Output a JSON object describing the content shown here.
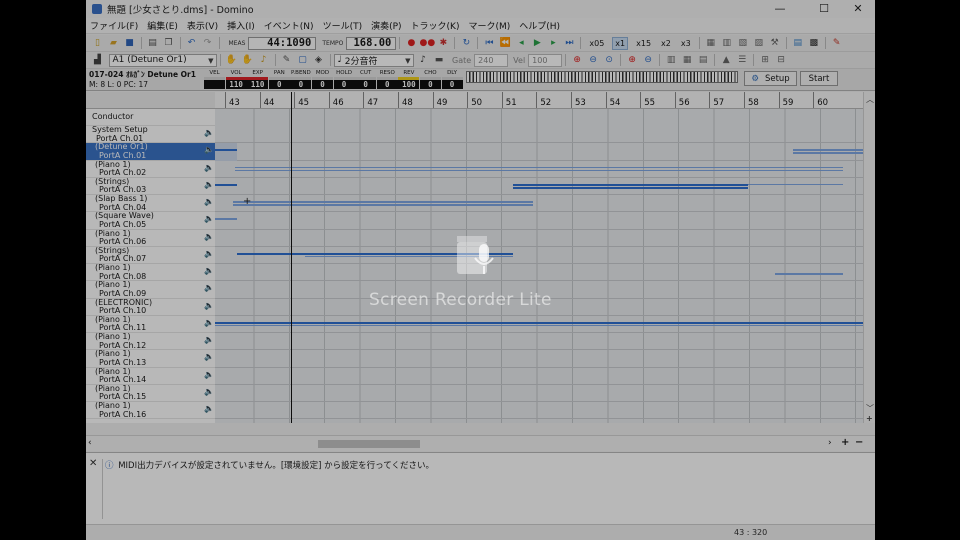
{
  "window": {
    "title": "無題 [少女さとり.dms] - Domino",
    "controls": [
      "—",
      "☐",
      "✕"
    ]
  },
  "menu": [
    "ファイル(F)",
    "編集(E)",
    "表示(V)",
    "挿入(I)",
    "イベント(N)",
    "ツール(T)",
    "演奏(P)",
    "トラック(K)",
    "マーク(M)",
    "ヘルプ(H)"
  ],
  "toolbar1": {
    "meas_label": "MEAS",
    "meas_value": "44:1090",
    "tempo_label": "TEMPO",
    "tempo_value": "168.00",
    "zoom": [
      "x05",
      "x1",
      "x15",
      "x2",
      "x3"
    ],
    "active_zoom": "x1"
  },
  "toolbar2": {
    "track_select": "A1  (Detune Or1)",
    "note_length": "2分音符",
    "gate_label": "Gate",
    "gate_value": "240",
    "vel_label": "Vel",
    "vel_value": "100"
  },
  "track_info": {
    "line1": "017-024 ｵﾙｶﾞﾝ Detune Or1",
    "line2": "M:    8   L:    0  PC:   17"
  },
  "params": [
    {
      "label": "VEL",
      "value": "",
      "color": "#d6d6d6"
    },
    {
      "label": "VOL",
      "value": "110",
      "color": "#e0242a"
    },
    {
      "label": "EXP",
      "value": "110",
      "color": "#e0242a"
    },
    {
      "label": "PAN",
      "value": "0",
      "color": "#d6d6d6"
    },
    {
      "label": "P.BEND",
      "value": "0",
      "color": "#d6d6d6"
    },
    {
      "label": "MOD",
      "value": "0",
      "color": "#d6d6d6"
    },
    {
      "label": "HOLD",
      "value": "0",
      "color": "#d6d6d6"
    },
    {
      "label": "CUT",
      "value": "0",
      "color": "#d6d6d6"
    },
    {
      "label": "RESO",
      "value": "0",
      "color": "#d6d6d6"
    },
    {
      "label": "REV",
      "value": "100",
      "color": "#f0d020"
    },
    {
      "label": "CHO",
      "value": "0",
      "color": "#d6d6d6"
    },
    {
      "label": "DLY",
      "value": "0",
      "color": "#d6d6d6"
    }
  ],
  "buttons": {
    "setup": "Setup",
    "start": "Start"
  },
  "ruler": [
    "43",
    "44",
    "45",
    "46",
    "47",
    "48",
    "49",
    "50",
    "51",
    "52",
    "53",
    "54",
    "55",
    "56",
    "57",
    "58",
    "59",
    "60"
  ],
  "conductor": "Conductor",
  "tracks": [
    {
      "name": "System Setup",
      "port": "PortA  Ch.01"
    },
    {
      "name": "(Detune Or1)",
      "port": "PortA  Ch.01"
    },
    {
      "name": "(Piano 1)",
      "port": "PortA  Ch.02"
    },
    {
      "name": "(Strings)",
      "port": "PortA  Ch.03"
    },
    {
      "name": "(Slap Bass 1)",
      "port": "PortA  Ch.04"
    },
    {
      "name": "(Square Wave)",
      "port": "PortA  Ch.05"
    },
    {
      "name": "(Piano 1)",
      "port": "PortA  Ch.06"
    },
    {
      "name": "(Strings)",
      "port": "PortA  Ch.07"
    },
    {
      "name": "(Piano 1)",
      "port": "PortA  Ch.08"
    },
    {
      "name": "(Piano 1)",
      "port": "PortA  Ch.09"
    },
    {
      "name": "(ELECTRONIC)",
      "port": "PortA  Ch.10"
    },
    {
      "name": "(Piano 1)",
      "port": "PortA  Ch.11"
    },
    {
      "name": "(Piano 1)",
      "port": "PortA  Ch.12"
    },
    {
      "name": "(Piano 1)",
      "port": "PortA  Ch.13"
    },
    {
      "name": "(Piano 1)",
      "port": "PortA  Ch.14"
    },
    {
      "name": "(Piano 1)",
      "port": "PortA  Ch.15"
    },
    {
      "name": "(Piano 1)",
      "port": "PortA  Ch.16"
    }
  ],
  "selected_track_index": 1,
  "message": "MIDI出力デバイスが設定されていません。[環境設定] から設定を行ってください。",
  "status_position": "43 : 320",
  "watermark": "Screen Recorder Lite"
}
